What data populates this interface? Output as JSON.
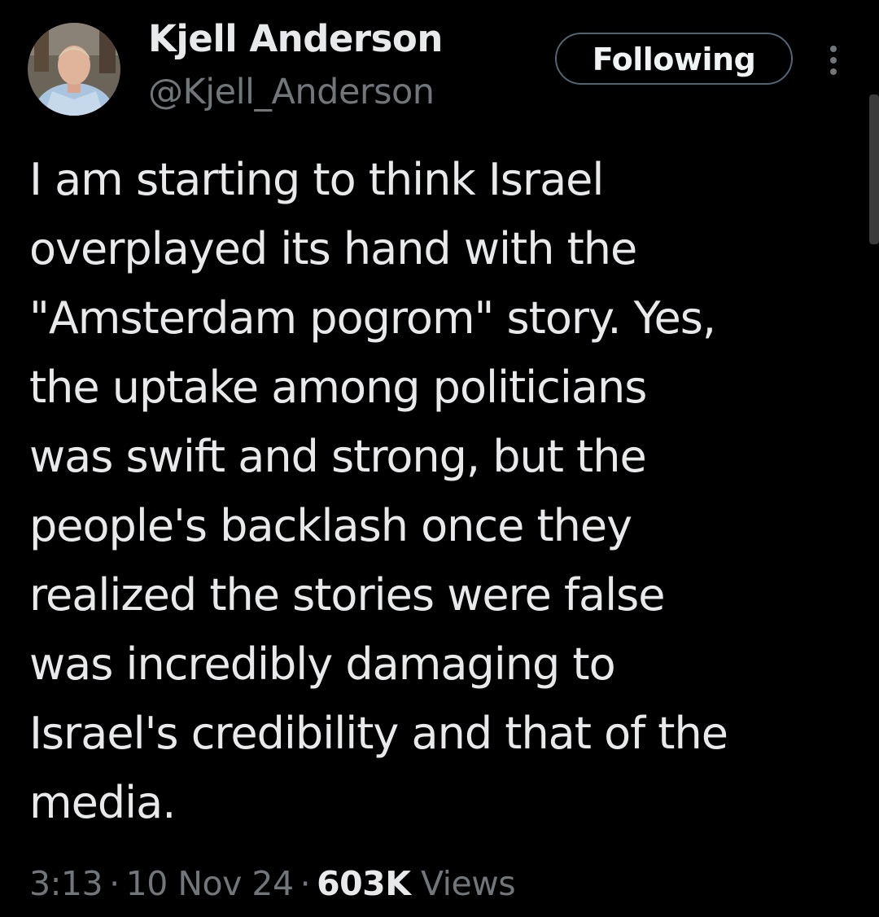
{
  "author": {
    "display_name": "Kjell Anderson",
    "handle": "@Kjell_Anderson",
    "avatar_icon": "profile-photo"
  },
  "follow_button": {
    "label": "Following"
  },
  "more_icon": "more-options-icon",
  "tweet": {
    "text": "I am starting to think Israel\noverplayed its hand with the\n\"Amsterdam pogrom\" story. Yes,\nthe uptake among politicians\nwas swift and strong, but the\npeople's backlash once they\nrealized the stories were false\nwas incredibly damaging to\nIsrael's credibility and that of the\nmedia."
  },
  "meta": {
    "time": "3:13",
    "separator": "·",
    "date": "10 Nov 24",
    "views_count": "603K",
    "views_label": "Views"
  },
  "colors": {
    "background": "#000000",
    "primary_text": "#e7e9ea",
    "secondary_text": "#71767b",
    "button_border": "#536471"
  }
}
